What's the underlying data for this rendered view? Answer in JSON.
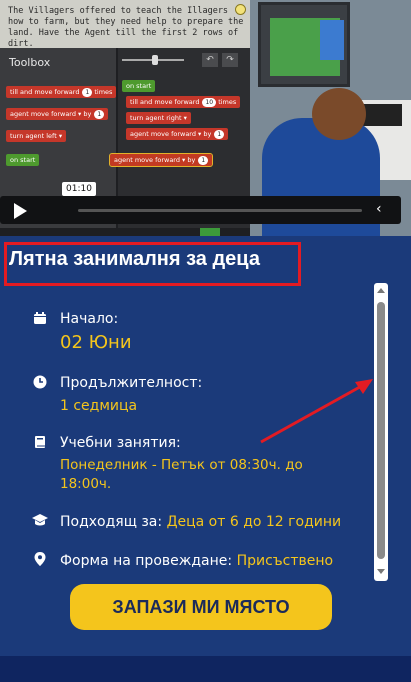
{
  "video": {
    "instructions": "The Villagers offered to teach the Illagers how to farm, but they need help to prepare the land. Have the Agent till the first 2 rows of dirt.",
    "toolbox_title": "Toolbox",
    "toolbox_blocks": [
      {
        "text": "till and move forward",
        "value": "1",
        "suffix": "times"
      },
      {
        "text": "agent move forward ▾ by",
        "value": "1"
      },
      {
        "text": "turn agent left ▾"
      }
    ],
    "toolbox_event": "on start",
    "workspace_event": "on start",
    "workspace_blocks": [
      {
        "text": "till and move forward",
        "value": "10",
        "suffix": "times"
      },
      {
        "text": "turn agent right ▾"
      },
      {
        "text": "agent move forward ▾ by",
        "value": "1"
      }
    ],
    "dragging_block": {
      "text": "agent move forward ▾ by",
      "value": "1"
    },
    "time": "01:10",
    "progress_pct": 0
  },
  "course": {
    "title_part1": "Лятна ",
    "title_part2": "занималня",
    "title_part3": " за деца",
    "start_label": "Начало:",
    "start_value": "02 Юни",
    "duration_label": "Продължителност:",
    "duration_value": "1 седмица",
    "schedule_label": "Учебни занятия:",
    "schedule_value_line1": "Понеделник - Петък от 08:30ч. до",
    "schedule_value_line2": "18:00ч.",
    "age_label": "Подходящ за: ",
    "age_value": "Деца от 6 до 12 години",
    "format_label": "Форма на провеждане: ",
    "format_value": "Присъствено",
    "cta": "ЗАПАЗИ МИ МЯСТО"
  },
  "colors": {
    "panel_bg": "#1b3a7a",
    "accent_yellow": "#f4c51c",
    "highlight_red": "#e31b23"
  }
}
